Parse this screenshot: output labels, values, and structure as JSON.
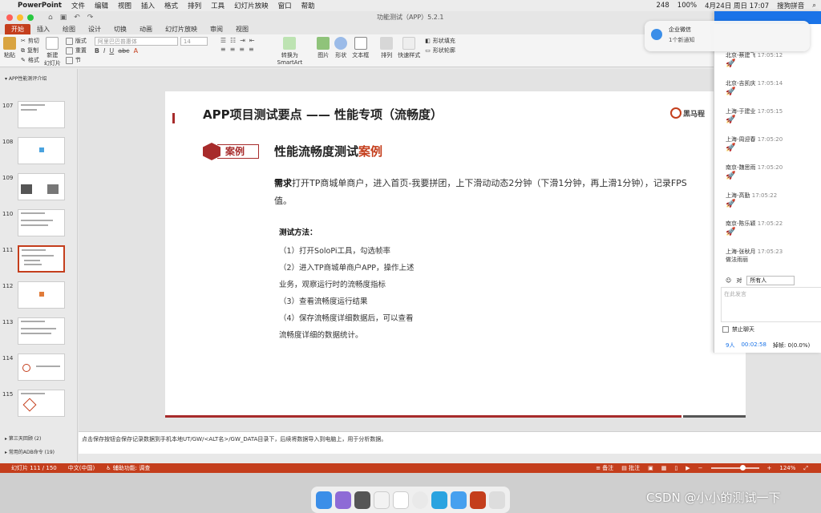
{
  "menubar": {
    "app": "PowerPoint",
    "items": [
      "文件",
      "编辑",
      "视图",
      "插入",
      "格式",
      "排列",
      "工具",
      "幻灯片放映",
      "窗口",
      "帮助"
    ],
    "status": [
      "248",
      "100%",
      "4月24日 周日 17:07",
      "搜狗拼音"
    ]
  },
  "window": {
    "doc_title": "功能测试（APP）5.2.1"
  },
  "tabs": [
    "开始",
    "插入",
    "绘图",
    "设计",
    "切换",
    "动画",
    "幻灯片放映",
    "审阅",
    "视图"
  ],
  "ribbon": {
    "paste": "粘贴",
    "cut": "剪切",
    "copy": "复制",
    "format": "格式",
    "new_slide": "新建\n幻灯片",
    "layout": "版式",
    "reset": "重置",
    "section": "节",
    "font_name": "阿里巴巴普惠体",
    "font_size": "14",
    "convert": "转换为\nSmartArt",
    "picture": "图片",
    "shape": "形状",
    "textbox": "文本框",
    "arrange": "排列",
    "quick_style": "快速样式",
    "shape_fill": "形状填充",
    "shape_outline": "形状轮廓"
  },
  "sidebar": {
    "section_top": "APP性能测评介绍",
    "slides": [
      "107",
      "108",
      "109",
      "110",
      "111",
      "112",
      "113",
      "114",
      "115"
    ],
    "selected": "111",
    "section_a": "第三天回顾 (2)",
    "section_b": "常用的ADB命令 (19)"
  },
  "slide": {
    "title": "APP项目测试要点 —— 性能专项（流畅度）",
    "logo": "黑马程",
    "badge": "案例",
    "case_title": "性能流畅度测试",
    "case_title_hl": "案例",
    "req_bold": "需求",
    "req_text": "打开TP商城单商户，进入首页-我要拼团，上下滑动动态2分钟（下滑1分钟，再上滑1分钟），记录FPS值。",
    "method_title": "测试方法：",
    "steps": [
      "（1）打开SoloPi工具，勾选帧率",
      "（2）进入TP商城单商户APP，操作上述",
      "业务，观察运行时的流畅度指标",
      "（3）查看流畅度运行结果",
      "（4）保存流畅度详细数据后，可以查看",
      "流畅度详细的数据统计。"
    ]
  },
  "notes": "点击保存按钮会保存记录数据到手机本地UT/GW/<ALT名>/GW_DATA目录下，后续将数据导入到电脑上，用于分析数据。",
  "status": {
    "slide": "幻灯片 111 / 150",
    "lang": "中文(中国)",
    "access": "辅助功能: 调查",
    "notes": "备注",
    "comments": "批注",
    "zoom": "124%"
  },
  "notif": {
    "title": "企业微信",
    "body": "1个新通知"
  },
  "chat": {
    "messages": [
      {
        "name": "北京-蔡建飞",
        "time": "17:05:12"
      },
      {
        "name": "北京-吉凯庆",
        "time": "17:05:14"
      },
      {
        "name": "上海-于建业",
        "time": "17:05:15"
      },
      {
        "name": "上海-周迎春",
        "time": "17:05:20"
      },
      {
        "name": "南京-魏思雨",
        "time": "17:05:20"
      },
      {
        "name": "上海-高勤",
        "time": "17:05:22"
      },
      {
        "name": "南京-陈乐颖",
        "time": "17:05:22"
      },
      {
        "name": "上海-张秋月",
        "time": "17:05:23",
        "text": "做法雨丽"
      }
    ],
    "to_label": "对",
    "to_value": "所有人",
    "input_placeholder": "在此发言",
    "ban": "禁止聊天",
    "count": "9人",
    "timer": "00:02:58",
    "lag": "掉帧: 0(0.0%)"
  },
  "watermark": "CSDN @小小的测试一下",
  "colors": {
    "accent": "#c43e1c",
    "dark_red": "#a72b2b",
    "chat_blue": "#1a73e8"
  }
}
